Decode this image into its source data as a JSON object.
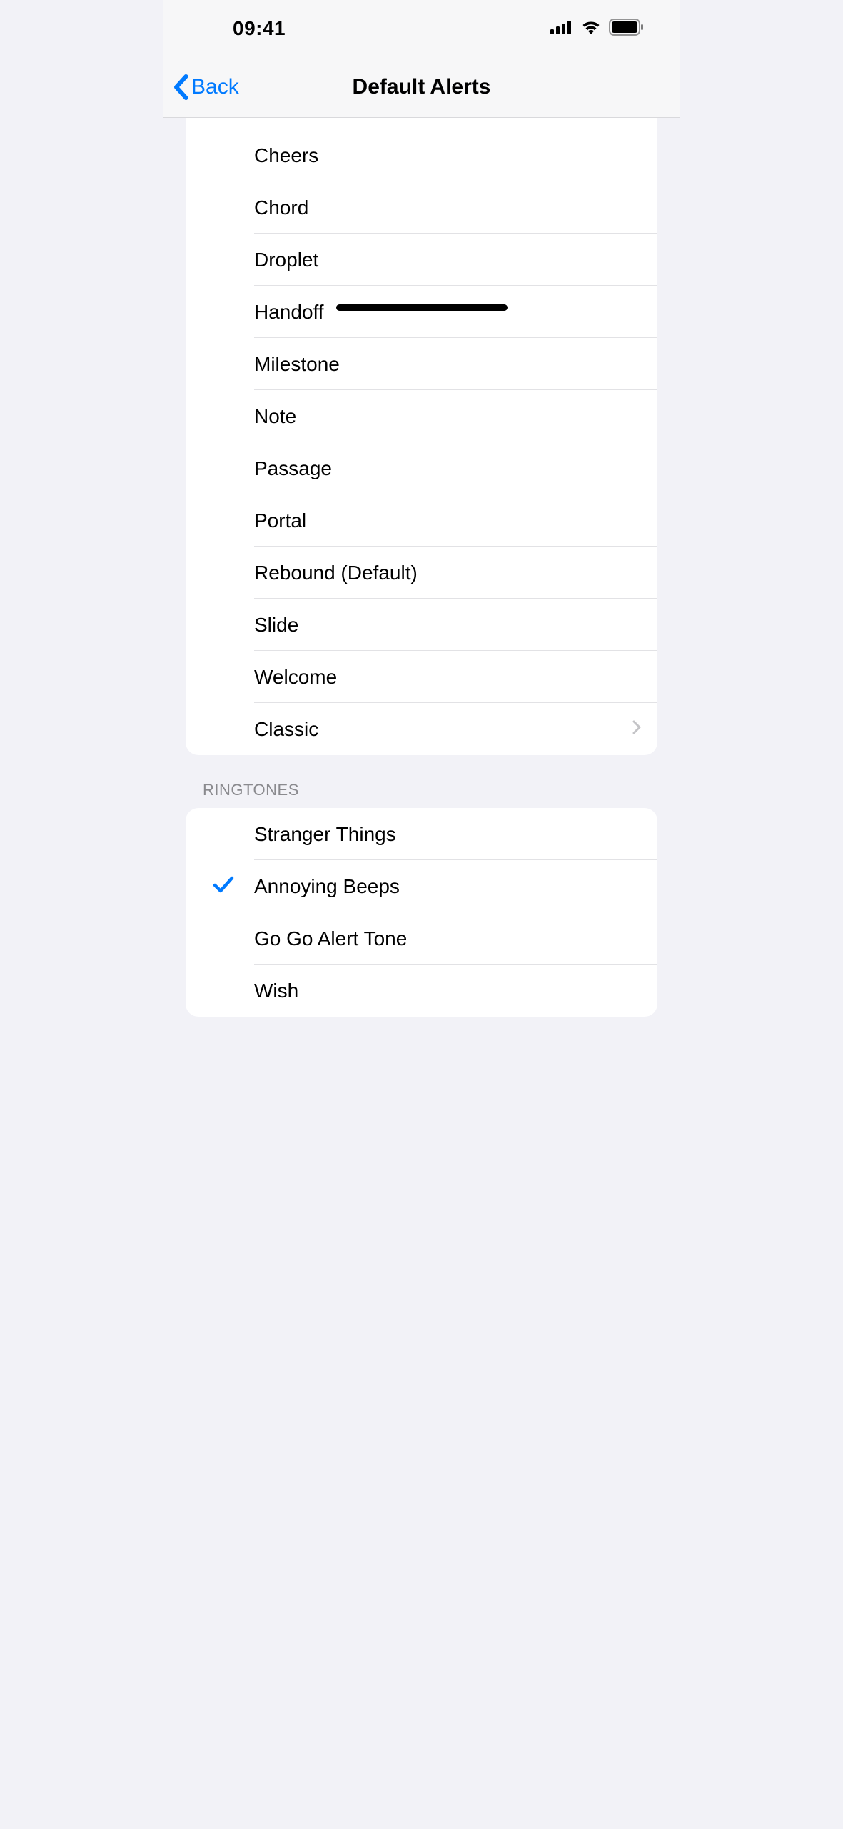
{
  "statusBar": {
    "time": "09:41"
  },
  "nav": {
    "backLabel": "Back",
    "title": "Default Alerts"
  },
  "alertTones": [
    {
      "label": "Cheers"
    },
    {
      "label": "Chord"
    },
    {
      "label": "Droplet"
    },
    {
      "label": "Handoff"
    },
    {
      "label": "Milestone"
    },
    {
      "label": "Note"
    },
    {
      "label": "Passage"
    },
    {
      "label": "Portal"
    },
    {
      "label": "Rebound (Default)"
    },
    {
      "label": "Slide"
    },
    {
      "label": "Welcome"
    },
    {
      "label": "Classic",
      "hasChevron": true
    }
  ],
  "ringtonesHeader": "RINGTONES",
  "ringtones": [
    {
      "label": "Stranger Things",
      "selected": false
    },
    {
      "label": "Annoying Beeps",
      "selected": true
    },
    {
      "label": "Go Go Alert Tone",
      "selected": false
    },
    {
      "label": "Wish",
      "selected": false
    }
  ]
}
